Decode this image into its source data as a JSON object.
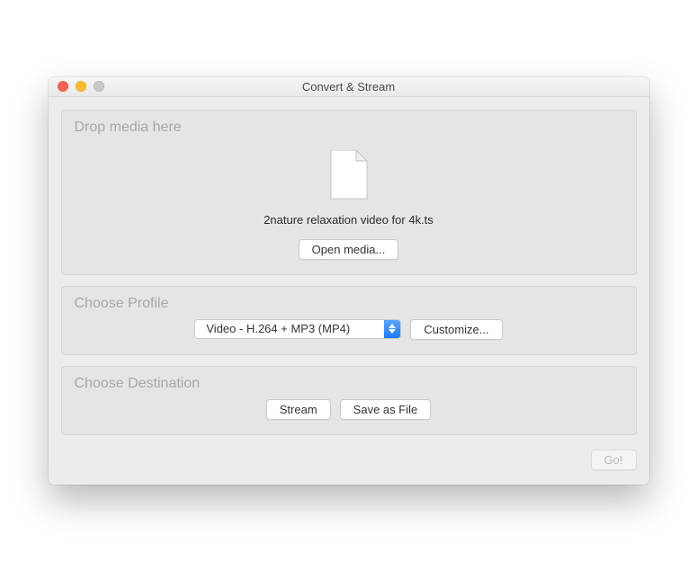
{
  "window": {
    "title": "Convert & Stream"
  },
  "drop": {
    "heading": "Drop media here",
    "filename": "2nature relaxation video for 4k.ts",
    "open_media_label": "Open media..."
  },
  "profile": {
    "heading": "Choose Profile",
    "selected": "Video - H.264 + MP3 (MP4)",
    "customize_label": "Customize..."
  },
  "destination": {
    "heading": "Choose Destination",
    "stream_label": "Stream",
    "save_as_file_label": "Save as File"
  },
  "footer": {
    "go_label": "Go!"
  }
}
